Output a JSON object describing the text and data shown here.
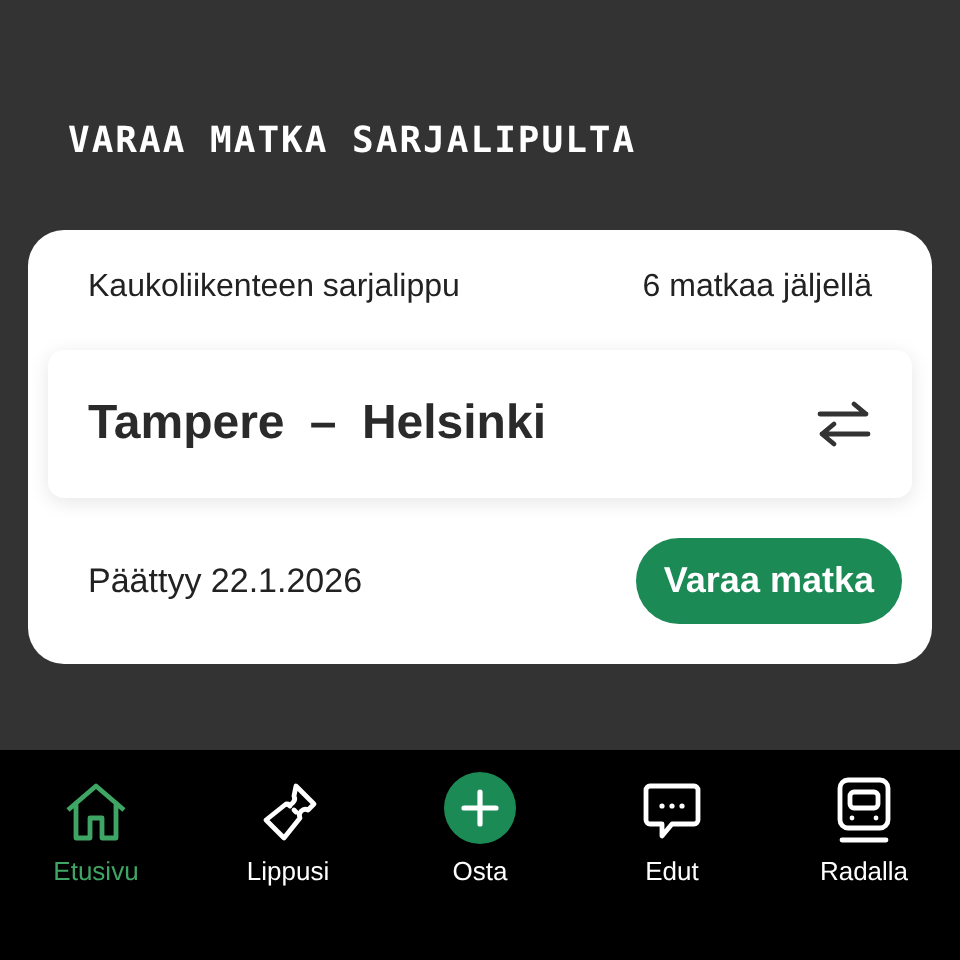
{
  "heading": "VARAA MATKA SARJALIPULTA",
  "card": {
    "ticket_name": "Kaukoliikenteen sarjalippu",
    "trips_left": "6 matkaa jäljellä",
    "route": "Tampere – Helsinki",
    "expiry": "Päättyy 22.1.2026",
    "book_button": "Varaa matka"
  },
  "nav": [
    {
      "label": "Etusivu",
      "selected": true
    },
    {
      "label": "Lippusi",
      "selected": false
    },
    {
      "label": "Osta",
      "selected": false
    },
    {
      "label": "Edut",
      "selected": false
    },
    {
      "label": "Radalla",
      "selected": false
    }
  ]
}
